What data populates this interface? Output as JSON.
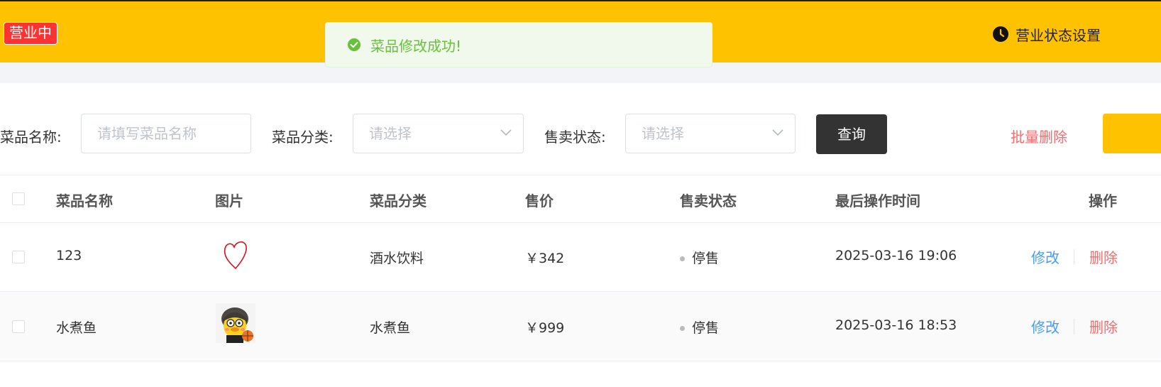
{
  "header": {
    "status_badge": "营业中",
    "business_setting": "营业状态设置",
    "colors": {
      "header_bg": "#ffc200",
      "badge_bg": "#fd3333"
    }
  },
  "toast": {
    "message": "菜品修改成功!",
    "type": "success",
    "icon": "check-circle-icon"
  },
  "filters": {
    "name_label": "菜品名称:",
    "name_placeholder": "请填写菜品名称",
    "category_label": "菜品分类:",
    "category_placeholder": "请选择",
    "status_label": "售卖状态:",
    "status_placeholder": "请选择",
    "query_button": "查询",
    "batch_delete": "批量删除"
  },
  "table": {
    "columns": [
      "菜品名称",
      "图片",
      "菜品分类",
      "售价",
      "售卖状态",
      "最后操作时间",
      "操作"
    ],
    "rows": [
      {
        "name": "123",
        "image": "heart-drawing-image",
        "category": "酒水饮料",
        "price": "￥342",
        "status": "停售",
        "updated": "2025-03-16 19:06",
        "edit": "修改",
        "delete": "删除"
      },
      {
        "name": "水煮鱼",
        "image": "duck-avatar-image",
        "category": "水煮鱼",
        "price": "￥999",
        "status": "停售",
        "updated": "2025-03-16 18:53",
        "edit": "修改",
        "delete": "删除"
      }
    ]
  }
}
